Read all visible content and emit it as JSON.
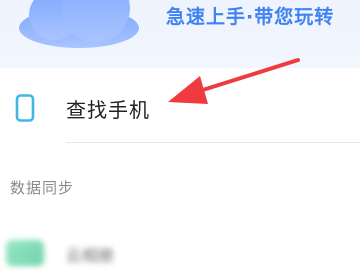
{
  "banner": {
    "text": "急速上手·带您玩转"
  },
  "items": [
    {
      "label": "查找手机",
      "icon": "phone-icon"
    }
  ],
  "sections": [
    {
      "title": "数据同步",
      "items": [
        {
          "label": "云相册",
          "icon": "cloud-album-icon"
        }
      ]
    }
  ],
  "colors": {
    "accent": "#3f83f2",
    "arrow": "#ef3b3f",
    "icon": "#3fb7e6"
  }
}
